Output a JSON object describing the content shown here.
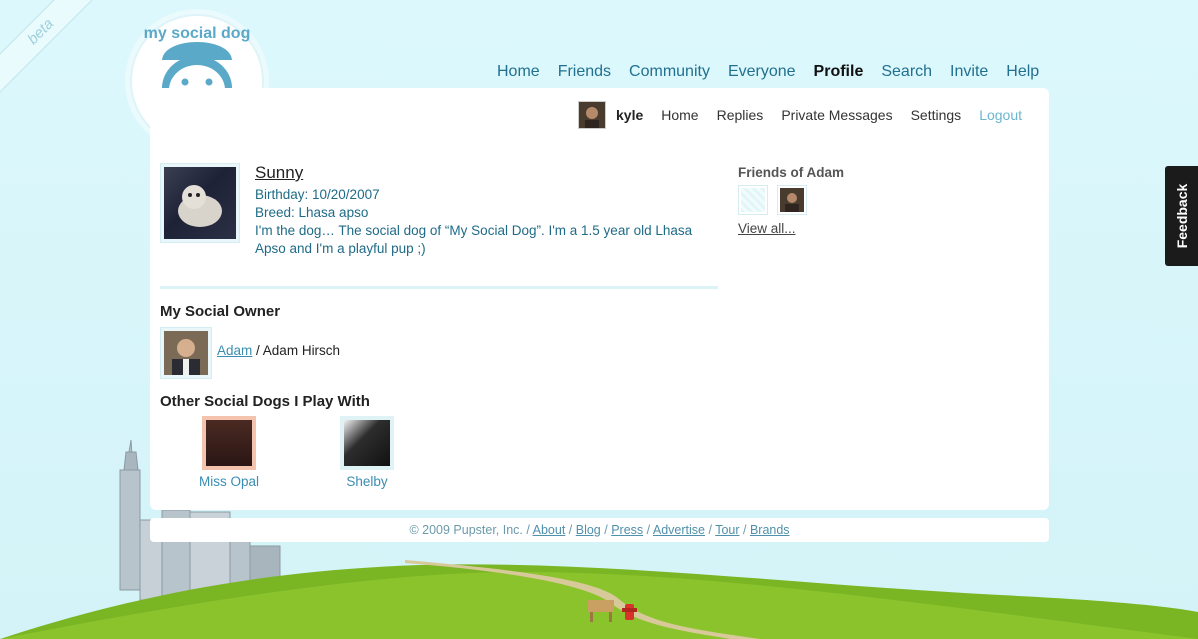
{
  "badge": "beta",
  "logo_text": "my social dog",
  "topnav": [
    "Home",
    "Friends",
    "Community",
    "Everyone",
    "Profile",
    "Search",
    "Invite",
    "Help"
  ],
  "subnav": {
    "user": "kyle",
    "links": [
      "Home",
      "Replies",
      "Private Messages",
      "Settings"
    ],
    "logout": "Logout"
  },
  "dog": {
    "name": "Sunny",
    "birthday": "Birthday: 10/20/2007",
    "breed": "Breed: Lhasa apso",
    "bio": "I'm the dog… The social dog of “My Social Dog”. I'm a 1.5 year old Lhasa Apso and I'm a playful pup ;)"
  },
  "owner": {
    "heading": "My Social Owner",
    "username": "Adam",
    "separator": " / ",
    "fullname": "Adam Hirsch"
  },
  "playmates": {
    "heading": "Other Social Dogs I Play With",
    "items": [
      {
        "name": "Miss Opal",
        "frame_color": "#f4c3ad",
        "photo_color": "#3a1d19"
      },
      {
        "name": "Shelby",
        "frame_color": "#dff3f7",
        "photo_color": "#2d2d2d"
      }
    ]
  },
  "friends": {
    "heading": "Friends of Adam",
    "view_all": "View all..."
  },
  "feedback": "Feedback",
  "footer": {
    "copyright": "© 2009 Pupster, Inc.",
    "links": [
      "About",
      "Blog",
      "Press",
      "Advertise",
      "Tour",
      "Brands"
    ]
  }
}
